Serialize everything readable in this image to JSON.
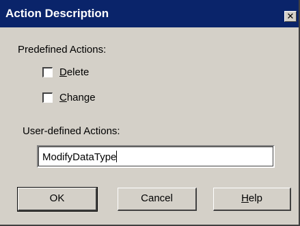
{
  "window": {
    "title": "Action Description",
    "close_symbol": "✕"
  },
  "predefined": {
    "label": "Predefined Actions:",
    "items": [
      {
        "mnemonic": "D",
        "rest": "elete",
        "checked": false
      },
      {
        "mnemonic": "C",
        "rest": "hange",
        "checked": false
      }
    ]
  },
  "user_defined": {
    "label": "User-defined Actions:",
    "value": "ModifyDataType"
  },
  "buttons": {
    "ok": "OK",
    "cancel": "Cancel",
    "help_mnemonic": "H",
    "help_rest": "elp"
  }
}
